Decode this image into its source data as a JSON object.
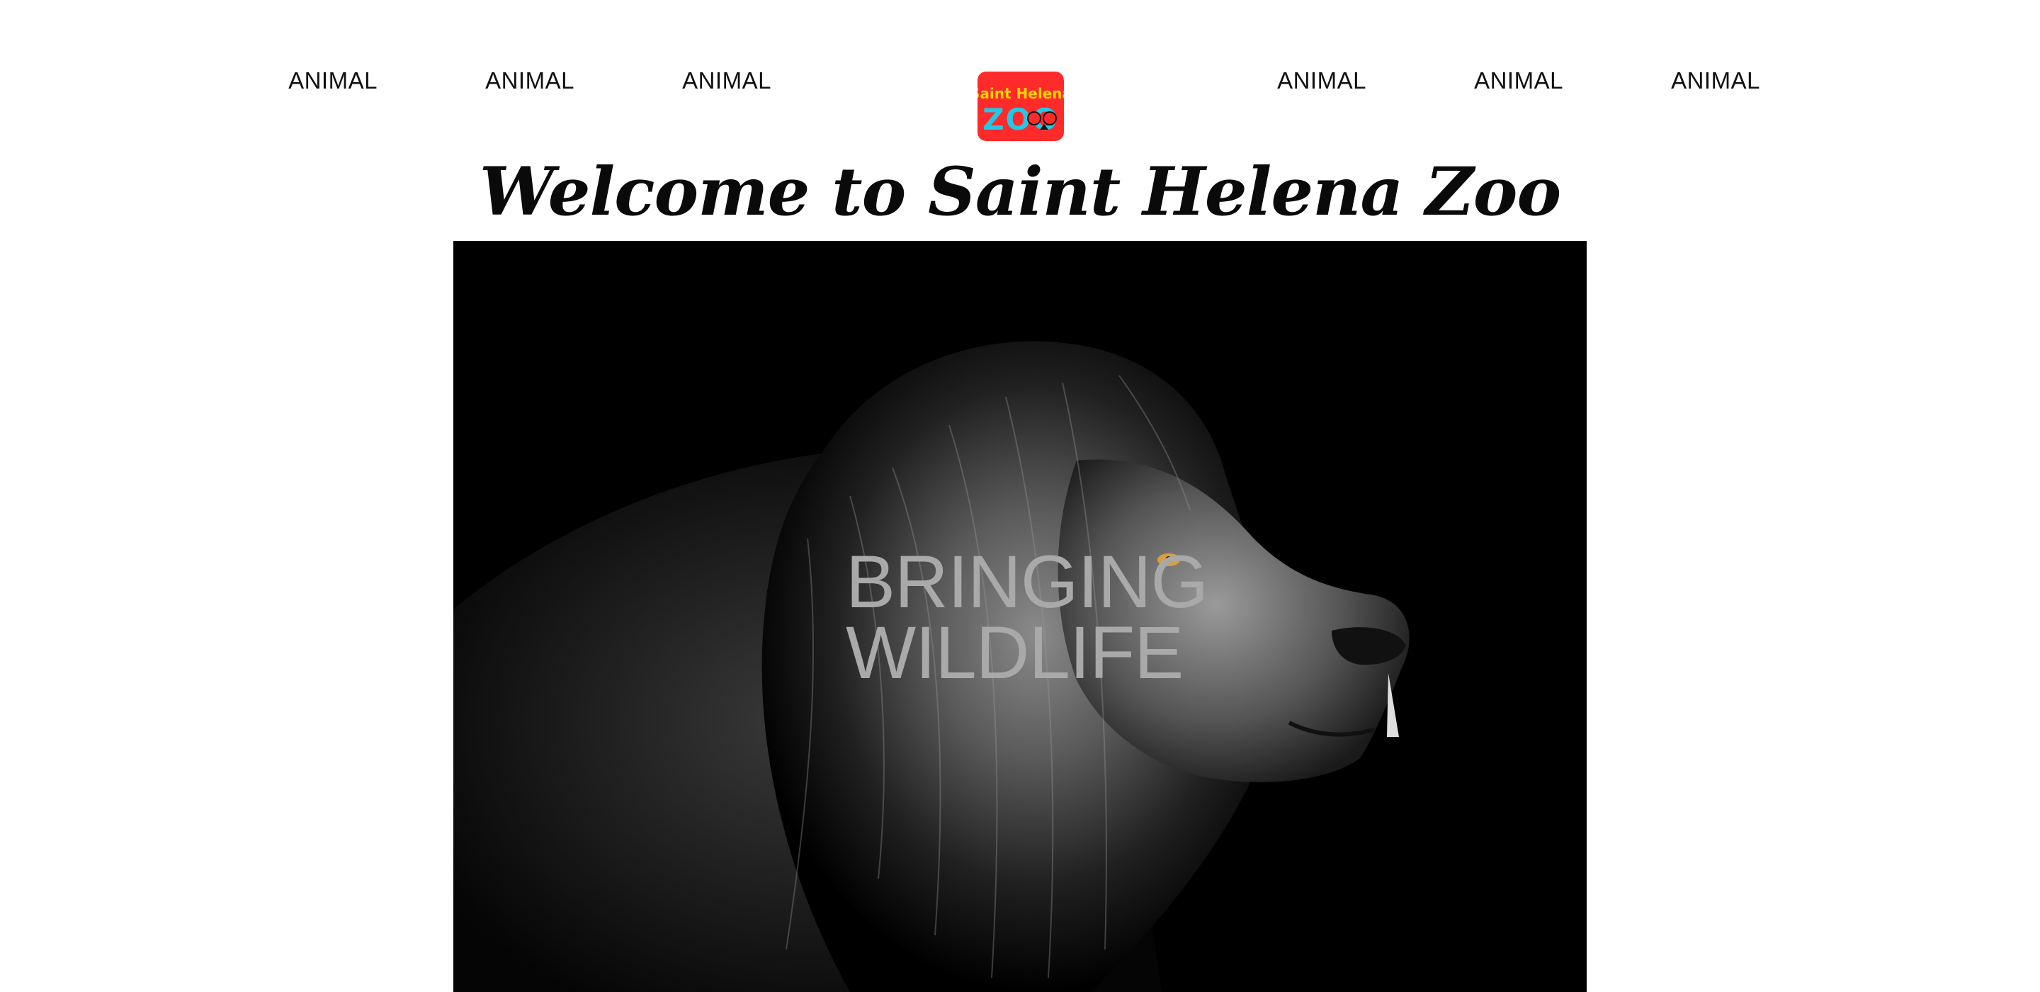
{
  "nav": {
    "left_items": [
      {
        "label": "ANIMAL"
      },
      {
        "label": "ANIMAL"
      },
      {
        "label": "ANIMAL"
      }
    ],
    "right_items": [
      {
        "label": "ANIMAL"
      },
      {
        "label": "ANIMAL"
      },
      {
        "label": "ANIMAL"
      }
    ]
  },
  "logo": {
    "line1": "Saint Helena",
    "line2": "ZOO",
    "colors": {
      "background": "#ff2a2a",
      "line1": "#ffd400",
      "line2": "#22c8e6"
    }
  },
  "page": {
    "title": "Welcome to Saint Helena Zoo"
  },
  "hero": {
    "image": "lion-portrait-monochrome",
    "headline_line1": "BRINGING",
    "headline_line2": "WILDLIFE",
    "colors": {
      "background": "#000000",
      "headline": "#a9a9a9"
    }
  }
}
